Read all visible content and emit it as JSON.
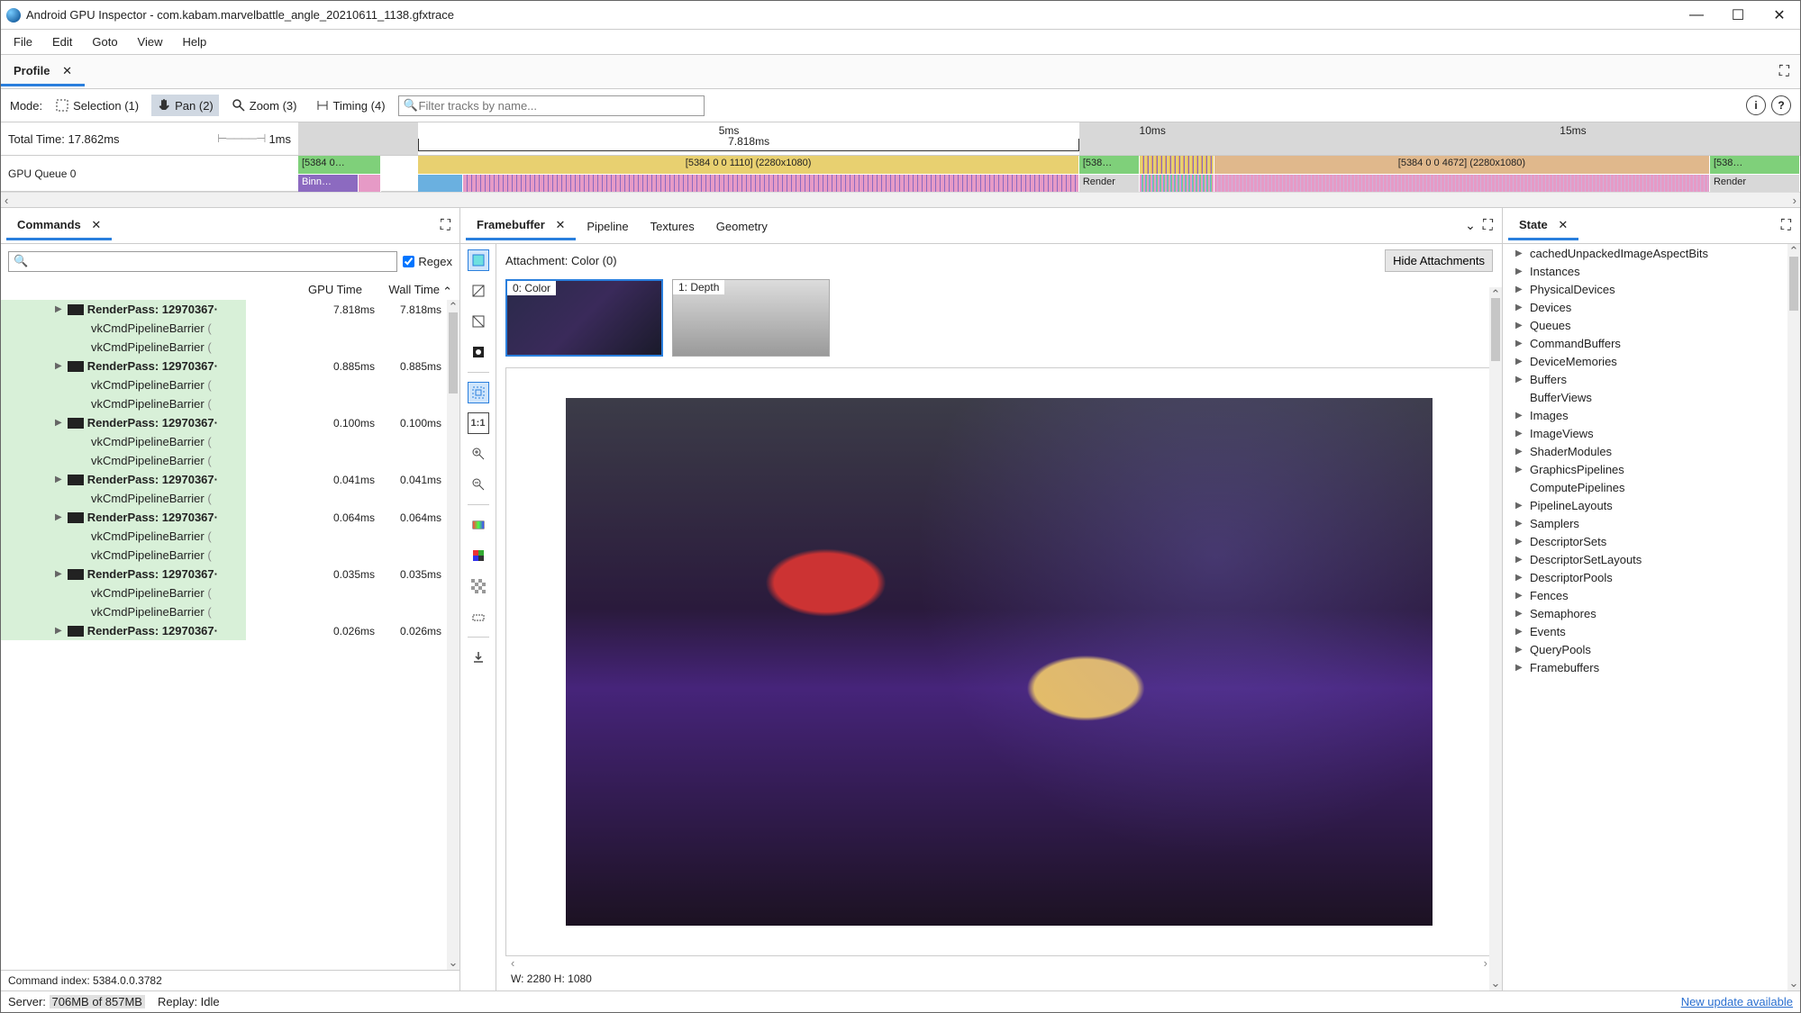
{
  "window": {
    "title": "Android GPU Inspector - com.kabam.marvelbattle_angle_20210611_1138.gfxtrace"
  },
  "menu": {
    "file": "File",
    "edit": "Edit",
    "goto": "Goto",
    "view": "View",
    "help": "Help"
  },
  "profile_tab": {
    "label": "Profile",
    "close": "✕"
  },
  "toolbar": {
    "mode_label": "Mode:",
    "sel": "Selection (1)",
    "pan": "Pan (2)",
    "zoom": "Zoom (3)",
    "timing": "Timing (4)",
    "filter_placeholder": "Filter tracks by name...",
    "info": "i",
    "help": "?"
  },
  "timeline": {
    "total_label": "Total Time: 17.862ms",
    "small_scale": "1ms",
    "bracket": "7.818ms",
    "ticks": [
      "5ms",
      "10ms",
      "15ms"
    ],
    "gpu_label": "GPU Queue 0",
    "blocks": {
      "b0": "[5384 0…",
      "b0b": "Binn…",
      "b1": "[5384 0 0 1110] (2280x1080)",
      "b2": "[538…",
      "b2b": "Render",
      "b3": "[5384 0 0 4672] (2280x1080)",
      "b4": "[538…",
      "b4b": "Render"
    }
  },
  "commands": {
    "tab": "Commands",
    "close": "✕",
    "regex": "Regex",
    "hdr_gpu": "GPU Time",
    "hdr_wall": "Wall Time",
    "rows": [
      {
        "t": "rp",
        "name": "RenderPass: 12970367·",
        "gpu": "7.818ms",
        "wall": "7.818ms"
      },
      {
        "t": "b",
        "name": "vkCmdPipelineBarrier"
      },
      {
        "t": "b",
        "name": "vkCmdPipelineBarrier"
      },
      {
        "t": "rp",
        "name": "RenderPass: 12970367·",
        "gpu": "0.885ms",
        "wall": "0.885ms"
      },
      {
        "t": "b",
        "name": "vkCmdPipelineBarrier"
      },
      {
        "t": "b",
        "name": "vkCmdPipelineBarrier"
      },
      {
        "t": "rp",
        "name": "RenderPass: 12970367·",
        "gpu": "0.100ms",
        "wall": "0.100ms"
      },
      {
        "t": "b",
        "name": "vkCmdPipelineBarrier"
      },
      {
        "t": "b",
        "name": "vkCmdPipelineBarrier"
      },
      {
        "t": "rp",
        "name": "RenderPass: 12970367·",
        "gpu": "0.041ms",
        "wall": "0.041ms"
      },
      {
        "t": "b",
        "name": "vkCmdPipelineBarrier"
      },
      {
        "t": "rp",
        "name": "RenderPass: 12970367·",
        "gpu": "0.064ms",
        "wall": "0.064ms"
      },
      {
        "t": "b",
        "name": "vkCmdPipelineBarrier"
      },
      {
        "t": "b",
        "name": "vkCmdPipelineBarrier"
      },
      {
        "t": "rp",
        "name": "RenderPass: 12970367·",
        "gpu": "0.035ms",
        "wall": "0.035ms"
      },
      {
        "t": "b",
        "name": "vkCmdPipelineBarrier"
      },
      {
        "t": "b",
        "name": "vkCmdPipelineBarrier"
      },
      {
        "t": "rp",
        "name": "RenderPass: 12970367·",
        "gpu": "0.026ms",
        "wall": "0.026ms"
      }
    ],
    "footer": "Command index: 5384.0.0.3782"
  },
  "framebuffer": {
    "tabs": {
      "fb": "Framebuffer",
      "pipe": "Pipeline",
      "tex": "Textures",
      "geo": "Geometry"
    },
    "close": "✕",
    "attach_label": "Attachment: Color (0)",
    "hide": "Hide Attachments",
    "thumb0": "0: Color",
    "thumb1": "1: Depth",
    "dim": "W: 2280 H: 1080",
    "tool_11": "1:1"
  },
  "state": {
    "tab": "State",
    "close": "✕",
    "items": [
      {
        "n": "cachedUnpackedImageAspectBits",
        "e": true
      },
      {
        "n": "Instances",
        "e": true
      },
      {
        "n": "PhysicalDevices",
        "e": true
      },
      {
        "n": "Devices",
        "e": true
      },
      {
        "n": "Queues",
        "e": true
      },
      {
        "n": "CommandBuffers",
        "e": true
      },
      {
        "n": "DeviceMemories",
        "e": true
      },
      {
        "n": "Buffers",
        "e": true
      },
      {
        "n": "BufferViews",
        "e": false
      },
      {
        "n": "Images",
        "e": true
      },
      {
        "n": "ImageViews",
        "e": true
      },
      {
        "n": "ShaderModules",
        "e": true
      },
      {
        "n": "GraphicsPipelines",
        "e": true
      },
      {
        "n": "ComputePipelines",
        "e": false
      },
      {
        "n": "PipelineLayouts",
        "e": true
      },
      {
        "n": "Samplers",
        "e": true
      },
      {
        "n": "DescriptorSets",
        "e": true
      },
      {
        "n": "DescriptorSetLayouts",
        "e": true
      },
      {
        "n": "DescriptorPools",
        "e": true
      },
      {
        "n": "Fences",
        "e": true
      },
      {
        "n": "Semaphores",
        "e": true
      },
      {
        "n": "Events",
        "e": true
      },
      {
        "n": "QueryPools",
        "e": true
      },
      {
        "n": "Framebuffers",
        "e": true
      }
    ]
  },
  "status": {
    "server": "Server:",
    "mem": "706MB of 857MB",
    "replay": "Replay: Idle",
    "update": "New update available"
  }
}
